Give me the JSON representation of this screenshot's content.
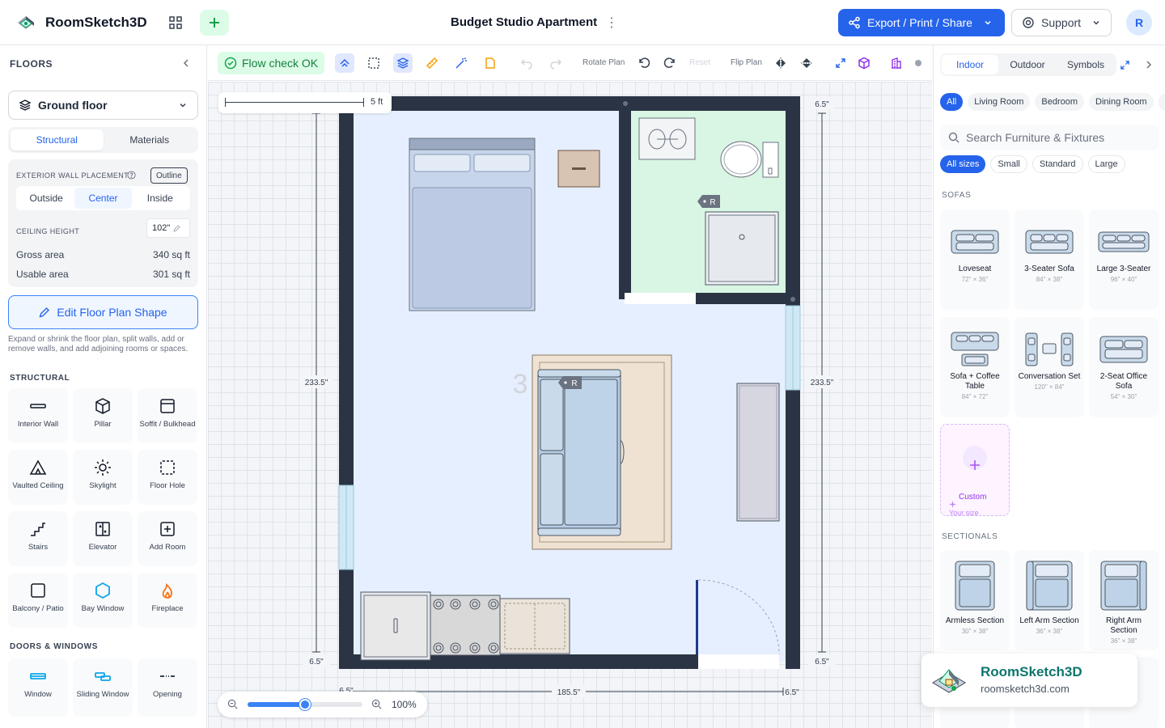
{
  "header": {
    "app_name": "RoomSketch3D",
    "doc_title": "Budget Studio Apartment",
    "export_label": "Export / Print / Share",
    "support_label": "Support",
    "avatar_initial": "R"
  },
  "left_panel": {
    "title": "FLOORS",
    "floor_select": "Ground floor",
    "tabs": [
      "Structural",
      "Materials"
    ],
    "active_tab": "Structural",
    "exterior_wall_label": "EXTERIOR WALL PLACEMENT",
    "outline_label": "Outline",
    "placement_options": [
      "Outside",
      "Center",
      "Inside"
    ],
    "placement_active": "Center",
    "ceiling_label": "CEILING HEIGHT",
    "ceiling_value": "102\"",
    "gross_label": "Gross area",
    "gross_value": "340 sq ft",
    "usable_label": "Usable area",
    "usable_value": "301 sq ft",
    "edit_button": "Edit Floor Plan Shape",
    "hint": "Expand or shrink the floor plan, split walls, add or remove walls, and add adjoining rooms or spaces.",
    "structural_title": "STRUCTURAL",
    "structural_tools": [
      "Interior Wall",
      "Pillar",
      "Soffit / Bulkhead",
      "Vaulted Ceiling",
      "Skylight",
      "Floor Hole",
      "Stairs",
      "Elevator",
      "Add Room",
      "Balcony / Patio",
      "Bay Window",
      "Fireplace"
    ],
    "doors_title": "DOORS & WINDOWS",
    "door_tools": [
      "Window",
      "Sliding Window",
      "Opening"
    ]
  },
  "toolbar": {
    "flow_check": "Flow check OK",
    "rotate_label": "Rotate Plan",
    "reset_label": "Reset",
    "flip_label": "Flip Plan"
  },
  "canvas": {
    "scale_label": "5 ft",
    "dim_top_right": "6.5\"",
    "dim_left": "233.5\"",
    "dim_right": "233.5\"",
    "dim_bottom_left": "6.5\"",
    "dim_bottom_right": "6.5\"",
    "dim_bottom_under": "6.5\"",
    "dim_bottom_mid": "185.5\"",
    "dim_bottom_end": "6.5\"",
    "room_number": "3",
    "tag_r": "R",
    "zoom_value": 0.5,
    "zoom_label": "100%"
  },
  "right_panel": {
    "tabs": [
      "Indoor",
      "Outdoor",
      "Symbols"
    ],
    "active_tab": "Indoor",
    "room_chips": [
      "All",
      "Living Room",
      "Bedroom",
      "Dining Room"
    ],
    "search_placeholder": "Search Furniture & Fixtures",
    "size_chips": [
      "All sizes",
      "Small",
      "Standard",
      "Large"
    ],
    "sofas_title": "SOFAS",
    "sofas": [
      {
        "name": "Loveseat",
        "size": "72\" × 36\""
      },
      {
        "name": "3-Seater Sofa",
        "size": "84\" × 38\""
      },
      {
        "name": "Large 3-Seater",
        "size": "96\" × 40\""
      },
      {
        "name": "Sofa + Coffee Table",
        "size": "84\" × 72\""
      },
      {
        "name": "Conversation Set",
        "size": "120\" × 84\""
      },
      {
        "name": "2-Seat Office Sofa",
        "size": "54\" × 30\""
      }
    ],
    "custom_label": "Custom",
    "custom_sub": "Your size",
    "sectionals_title": "SECTIONALS",
    "sectionals": [
      {
        "name": "Armless Section",
        "size": "30\" × 38\""
      },
      {
        "name": "Left Arm Section",
        "size": "36\" × 38\""
      },
      {
        "name": "Right Arm Section",
        "size": "36\" × 38\""
      }
    ]
  },
  "brand": {
    "name": "RoomSketch3D",
    "url": "roomsketch3d.com"
  }
}
